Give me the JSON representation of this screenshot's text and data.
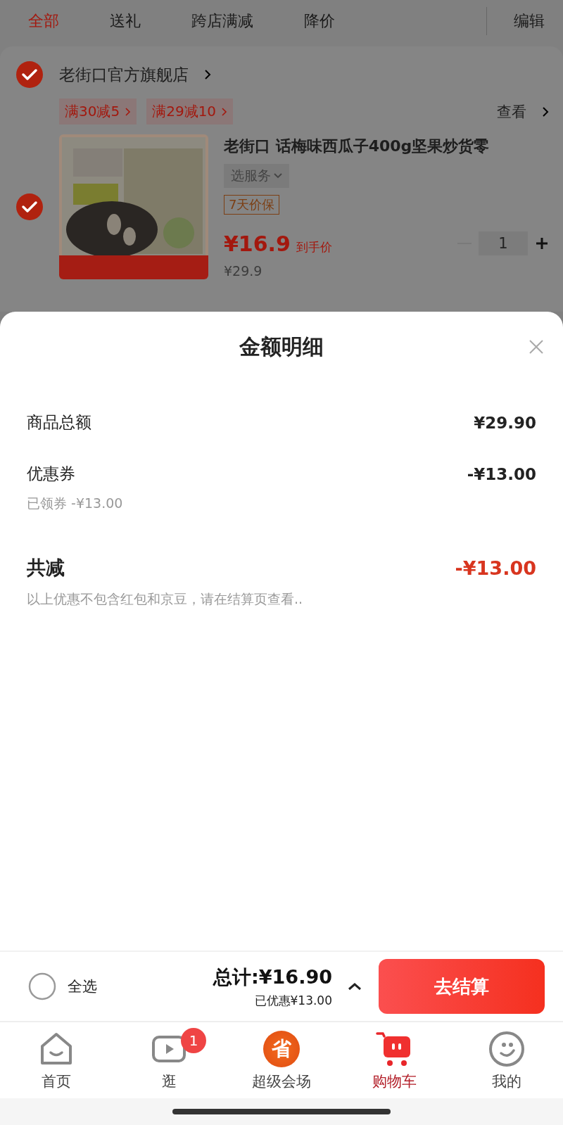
{
  "filter_tabs": [
    {
      "label": "全部",
      "selected": true
    },
    {
      "label": "送礼",
      "selected": false
    },
    {
      "label": "跨店满减",
      "selected": false
    },
    {
      "label": "降价",
      "selected": false
    }
  ],
  "edit_button": "编辑",
  "store": {
    "name": "老街口官方旗舰店",
    "checked": true,
    "promotions": [
      "满30减5",
      "满29减10"
    ],
    "view_link": "查看"
  },
  "product": {
    "checked": true,
    "title": "老街口 话梅味西瓜子400g坚果炒货零",
    "service": "选服务",
    "tag": "7天价保",
    "price": "¥16.9",
    "price_note": "到手价",
    "original_price": "¥29.9",
    "quantity": "1"
  },
  "sheet": {
    "title": "金额明细",
    "lines": [
      {
        "kind": "item",
        "label": "商品总额",
        "amount": "¥29.90"
      },
      {
        "kind": "item",
        "label": "优惠券",
        "amount": "-¥13.00",
        "note": "已领券 -¥13.00"
      },
      {
        "kind": "sum",
        "label": "共减",
        "amount": "-¥13.00",
        "note": "以上优惠不包含红包和京豆，请在结算页查看.."
      }
    ]
  },
  "checkout": {
    "select_all": {
      "label": "全选",
      "checked": false
    },
    "total": "总计:¥16.90",
    "saved": "已优惠¥13.00",
    "button": "去结算"
  },
  "nav": [
    {
      "kind": "home",
      "label": "首页",
      "selected": false
    },
    {
      "kind": "video",
      "label": "逛",
      "selected": false,
      "badge": "1"
    },
    {
      "kind": "promo",
      "label": "超级会场",
      "selected": false,
      "icon_text": "省"
    },
    {
      "kind": "cart",
      "label": "购物车",
      "selected": true
    },
    {
      "kind": "face",
      "label": "我的",
      "selected": false
    }
  ]
}
